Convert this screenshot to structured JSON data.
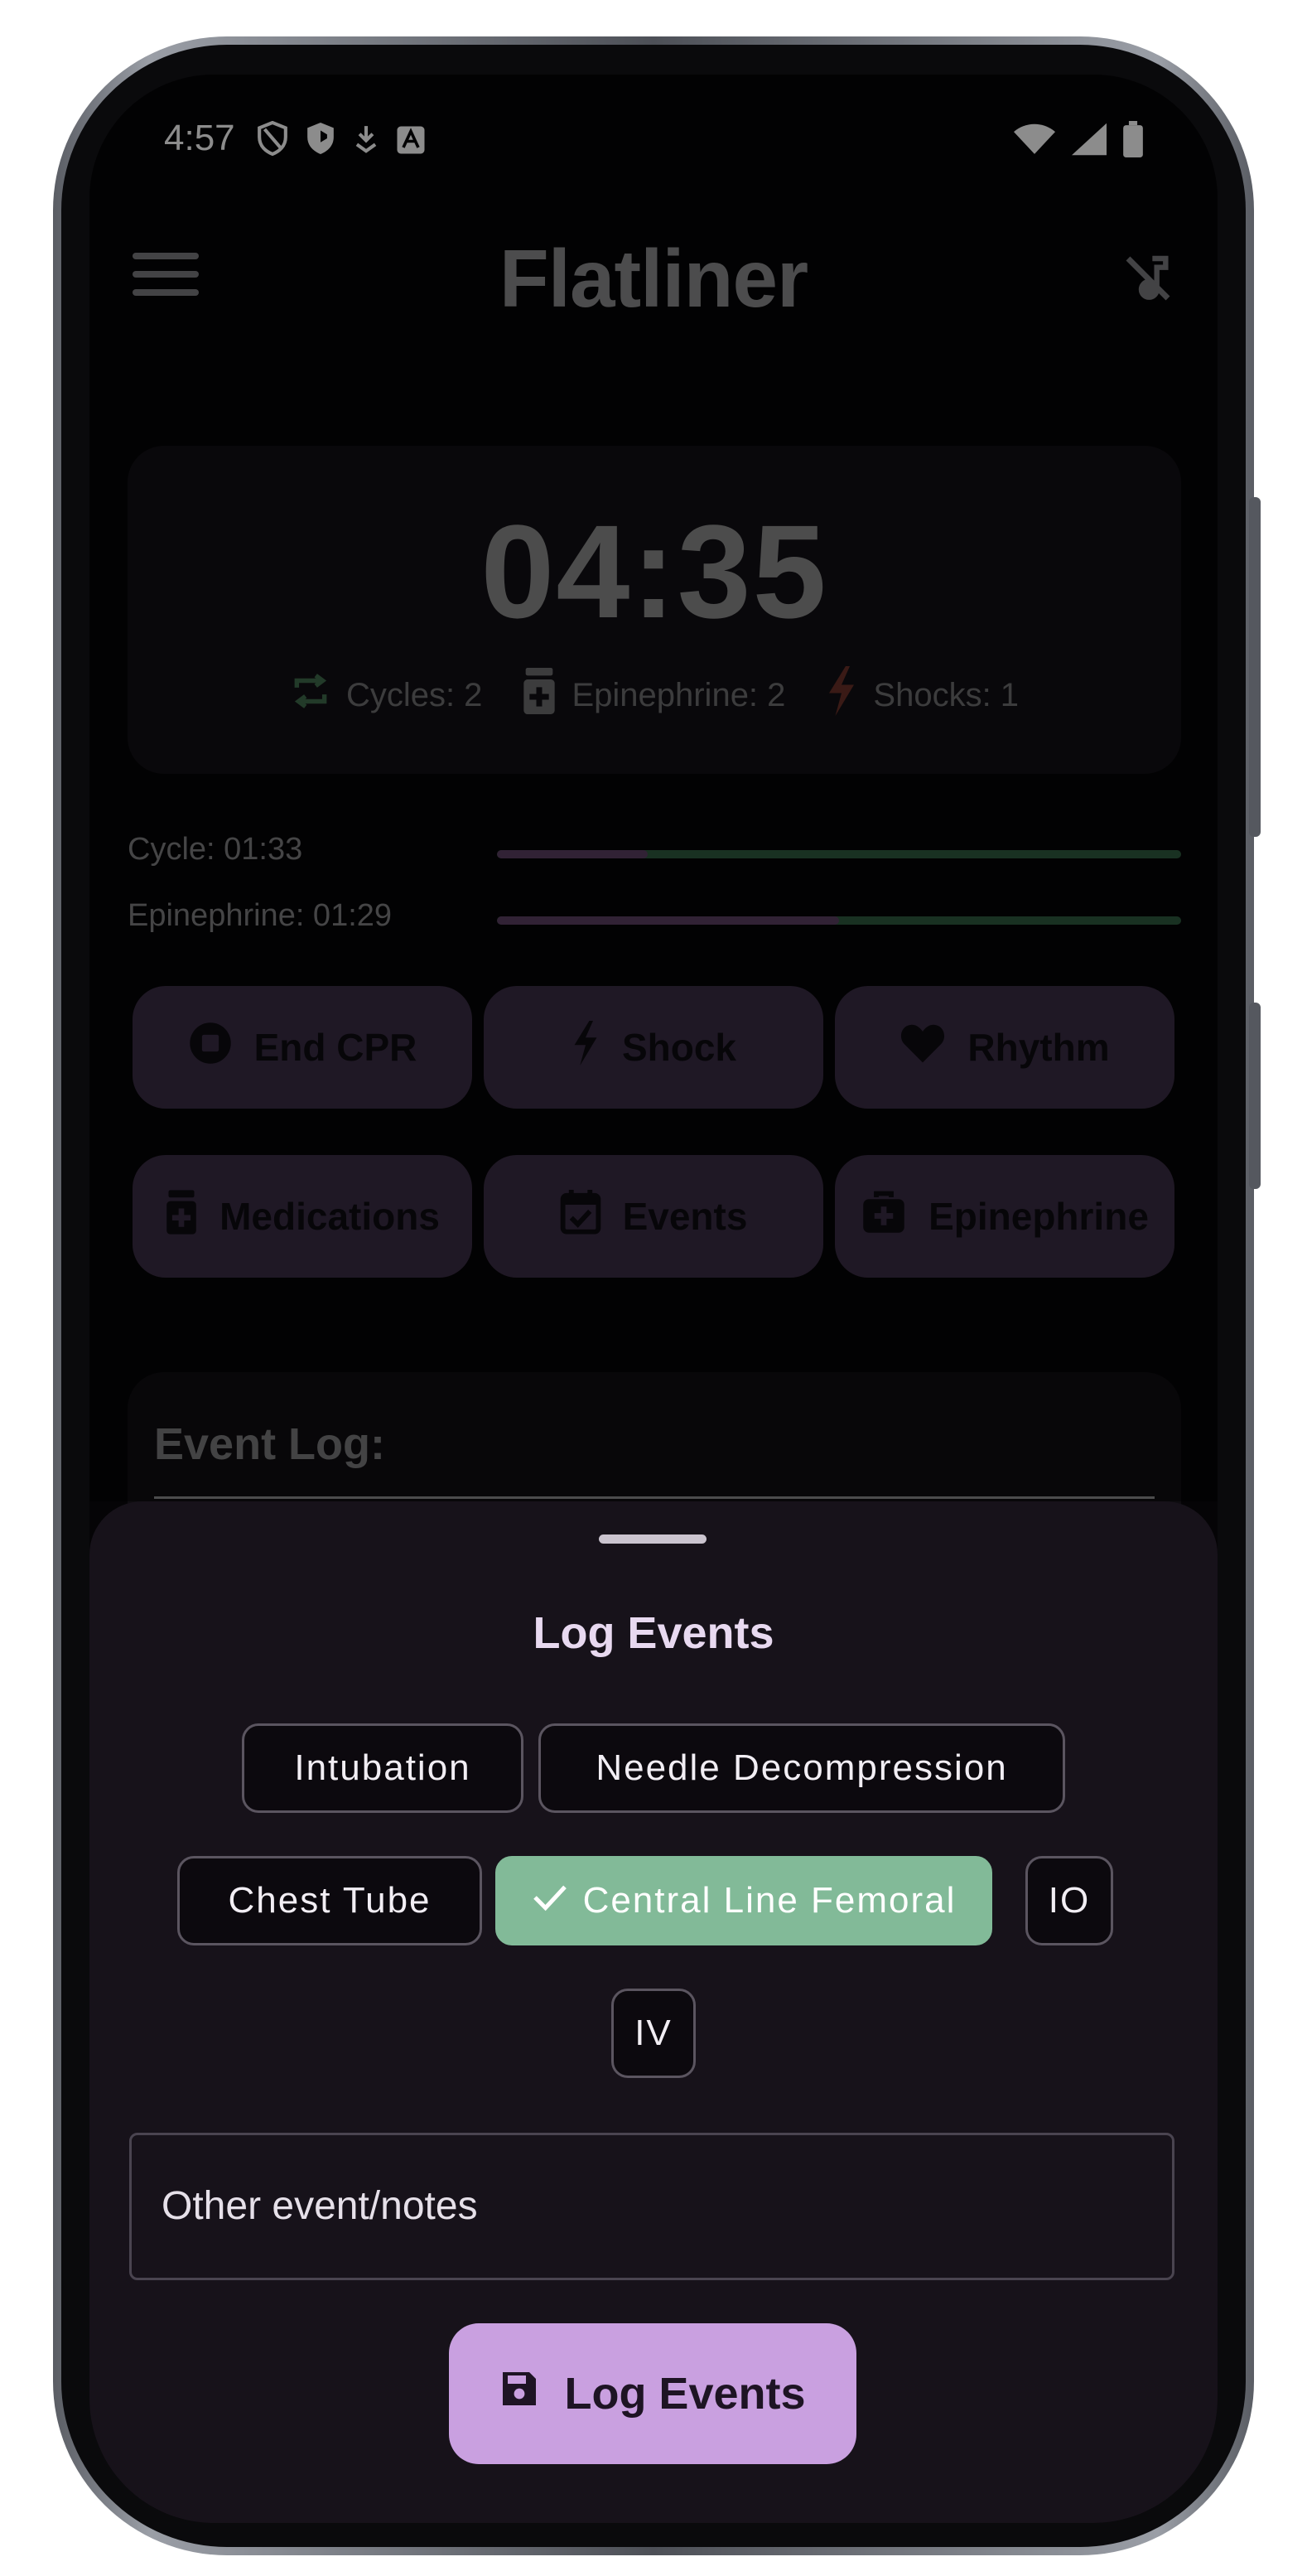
{
  "status_bar": {
    "time": "4:57",
    "left_icons": [
      "shield-outline-icon",
      "shield-filled-icon",
      "download-icon",
      "text-app-icon"
    ],
    "right_icons": [
      "wifi-icon",
      "signal-icon",
      "battery-icon"
    ]
  },
  "app_bar": {
    "title": "Flatliner",
    "menu_icon": "menu-icon",
    "mute_icon": "music-off-icon"
  },
  "timer_card": {
    "elapsed": "04:35",
    "counts": [
      {
        "icon": "repeat-icon",
        "label": "Cycles: 2",
        "color": "#3f6a4c"
      },
      {
        "icon": "medication-icon",
        "label": "Epinephrine: 2",
        "color": "#6e6e70"
      },
      {
        "icon": "bolt-icon",
        "label": "Shocks: 1",
        "color": "#6a3028"
      }
    ]
  },
  "progress": [
    {
      "label": "Cycle: 01:33",
      "fraction": 0.22
    },
    {
      "label": "Epinephrine: 01:29",
      "fraction": 0.5
    }
  ],
  "actions": {
    "row1": [
      {
        "icon": "stop-circle-icon",
        "label": "End CPR"
      },
      {
        "icon": "bolt-icon",
        "label": "Shock"
      },
      {
        "icon": "heart-icon",
        "label": "Rhythm"
      }
    ],
    "row2": [
      {
        "icon": "medication-icon",
        "label": "Medications"
      },
      {
        "icon": "calendar-check-icon",
        "label": "Events"
      },
      {
        "icon": "medical-kit-icon",
        "label": "Epinephrine"
      }
    ]
  },
  "event_log": {
    "title": "Event Log:"
  },
  "sheet": {
    "title": "Log Events",
    "chips": [
      {
        "label": "Intubation",
        "selected": false
      },
      {
        "label": "Needle Decompression",
        "selected": false
      },
      {
        "label": "Chest Tube",
        "selected": false
      },
      {
        "label": "Central Line Femoral",
        "selected": true
      },
      {
        "label": "IO",
        "selected": false
      },
      {
        "label": "IV",
        "selected": false
      }
    ],
    "notes_placeholder": "Other event/notes",
    "submit_label": "Log Events",
    "submit_icon": "save-icon"
  },
  "colors": {
    "accent": "#c9a0e0",
    "selected_chip": "#82ba98",
    "button_bg": "#3a2c44",
    "progress_done": "#5a3f62",
    "progress_remaining": "#2f5a3e"
  }
}
